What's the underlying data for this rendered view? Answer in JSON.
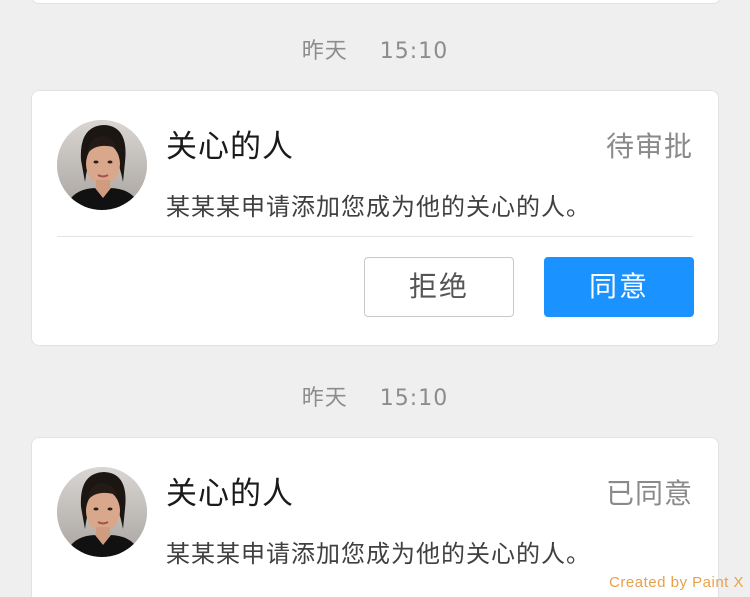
{
  "notifications": [
    {
      "time": {
        "day": "昨天",
        "clock": "15:10"
      },
      "title": "关心的人",
      "status": "待审批",
      "message": "某某某申请添加您成为他的关心的人。",
      "actions": {
        "reject_label": "拒绝",
        "agree_label": "同意"
      }
    },
    {
      "time": {
        "day": "昨天",
        "clock": "15:10"
      },
      "title": "关心的人",
      "status": "已同意",
      "message": "某某某申请添加您成为他的关心的人。"
    }
  ],
  "watermark": "Created by Paint X",
  "colors": {
    "background": "#efefef",
    "accent": "#1a92ff",
    "watermark": "#e8a04a"
  }
}
